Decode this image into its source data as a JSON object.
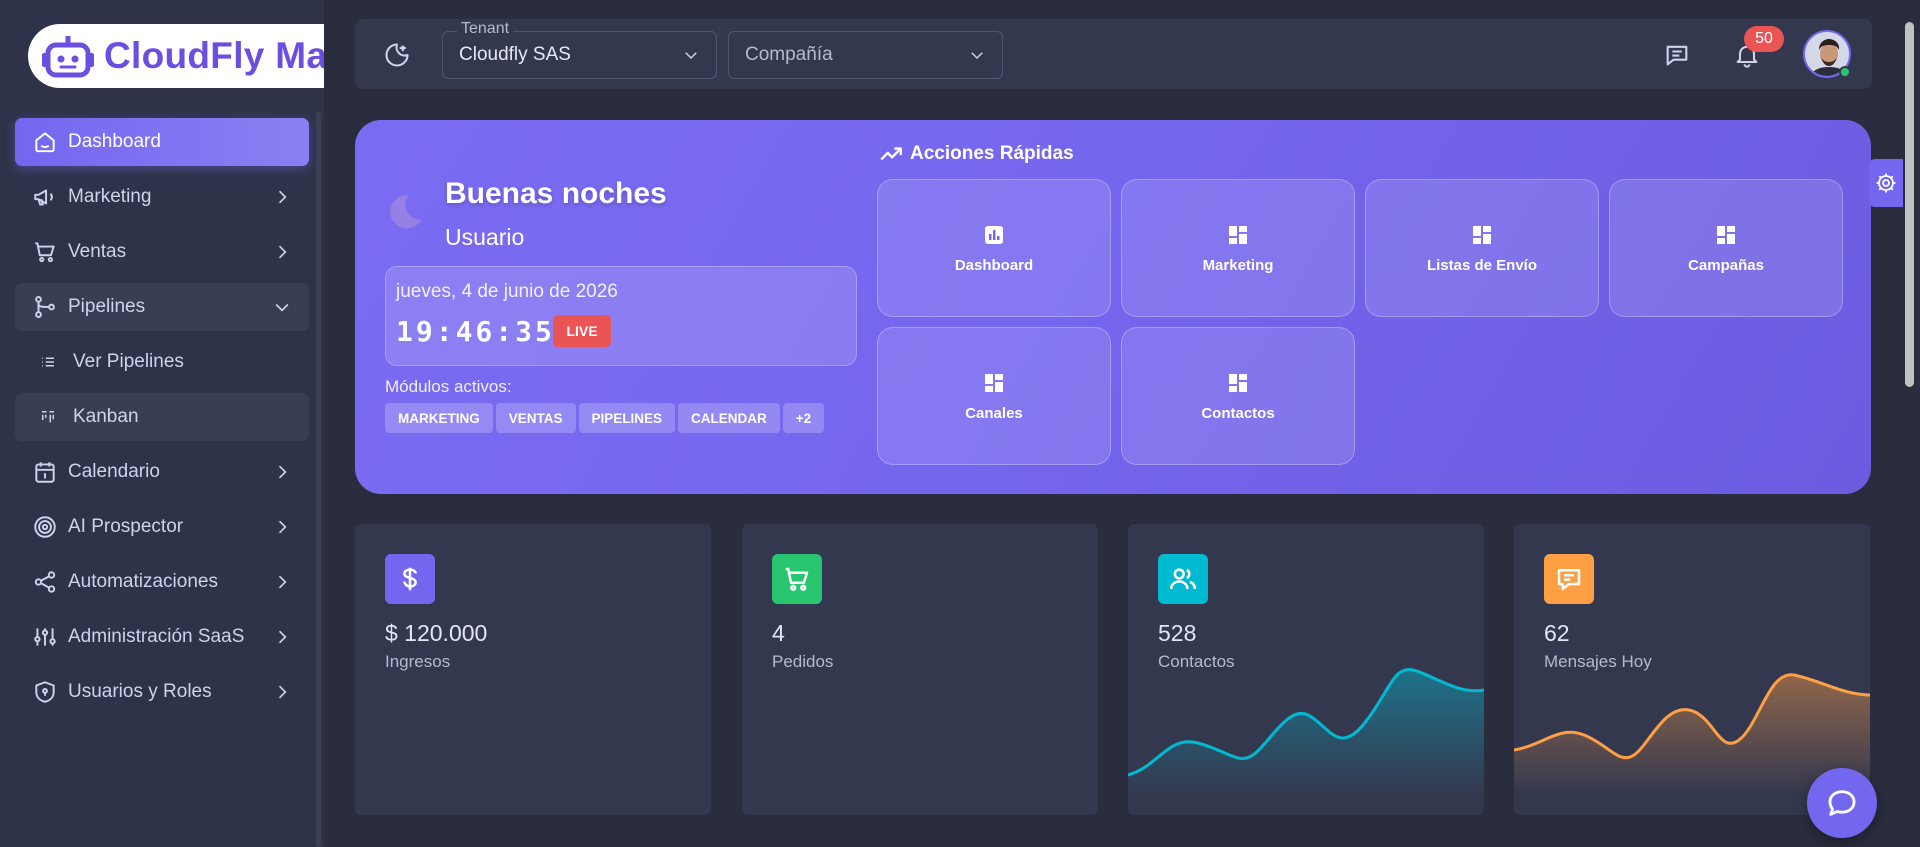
{
  "brand": {
    "name": "CloudFly Ma",
    "color": "#6b4fe0"
  },
  "sidebar": {
    "items": [
      {
        "label": "Dashboard",
        "icon": "home-icon"
      },
      {
        "label": "Marketing",
        "icon": "megaphone-icon"
      },
      {
        "label": "Ventas",
        "icon": "cart-icon"
      },
      {
        "label": "Pipelines",
        "icon": "git-branch-icon"
      },
      {
        "label": "Ver Pipelines",
        "icon": "list-icon"
      },
      {
        "label": "Kanban",
        "icon": "kanban-icon"
      },
      {
        "label": "Calendario",
        "icon": "calendar-icon"
      },
      {
        "label": "AI Prospector",
        "icon": "target-icon"
      },
      {
        "label": "Automatizaciones",
        "icon": "share-nodes-icon"
      },
      {
        "label": "Administración SaaS",
        "icon": "sliders-icon"
      },
      {
        "label": "Usuarios y Roles",
        "icon": "shield-icon"
      }
    ]
  },
  "topbar": {
    "tenant": {
      "legend": "Tenant",
      "value": "Cloudfly SAS"
    },
    "company": {
      "placeholder": "Compañía"
    },
    "notifications": {
      "count": "50"
    }
  },
  "hero": {
    "greeting": "Buenas noches",
    "user": "Usuario",
    "date": "jueves, 4 de junio de 2026",
    "time": "19:46:35",
    "live": "LIVE",
    "modules_label": "Módulos activos:",
    "modules": [
      "MARKETING",
      "VENTAS",
      "PIPELINES",
      "CALENDAR",
      "+2"
    ],
    "quick_actions": {
      "title": "Acciones Rápidas",
      "items": [
        "Dashboard",
        "Marketing",
        "Listas de Envío",
        "Campañas",
        "Canales",
        "Contactos"
      ]
    }
  },
  "stats": [
    {
      "value": "$ 120.000",
      "label": "Ingresos",
      "icon": "dollar-icon",
      "color": "#7367f0"
    },
    {
      "value": "4",
      "label": "Pedidos",
      "icon": "cart-icon",
      "color": "#28c76f"
    },
    {
      "value": "528",
      "label": "Contactos",
      "icon": "users-icon",
      "color": "#00bad1"
    },
    {
      "value": "62",
      "label": "Mensajes Hoy",
      "icon": "message-icon",
      "color": "#ff9f43"
    }
  ],
  "colors": {
    "accent": "#7367f0",
    "danger": "#ea5455",
    "success": "#28c76f",
    "info": "#00bad1",
    "warning": "#ff9f43"
  }
}
